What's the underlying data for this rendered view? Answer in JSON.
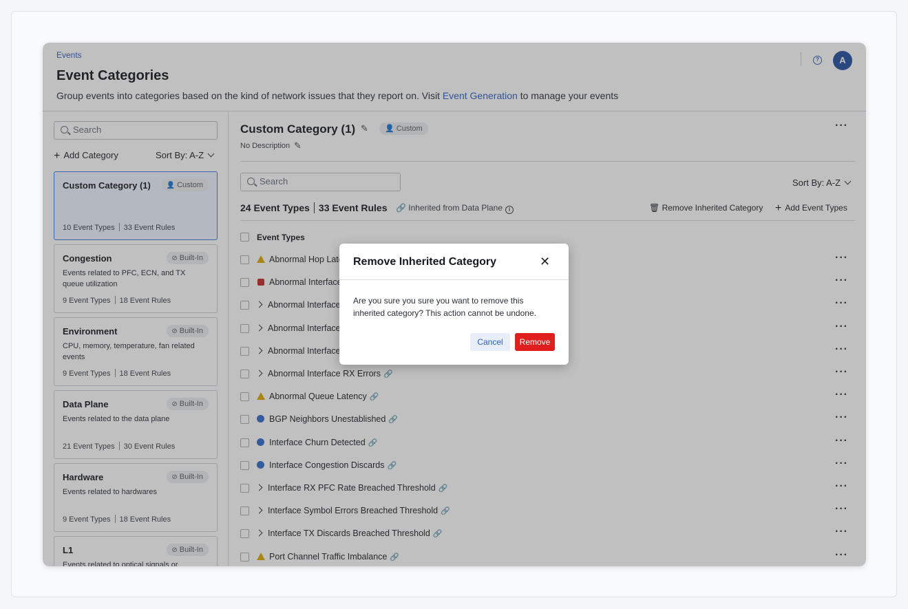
{
  "header": {
    "breadcrumb": "Events",
    "title": "Event Categories",
    "subtitle_before": "Group events into categories based on the kind of network issues that they report on. Visit ",
    "subtitle_link": "Event Generation",
    "subtitle_after": " to manage your events",
    "help_glyph": "?",
    "avatar_initial": "A"
  },
  "sidebar": {
    "search_placeholder": "Search",
    "add_label": "Add Category",
    "sort_label": "Sort By: A-Z",
    "categories": [
      {
        "name": "Custom Category (1)",
        "badge": "Custom",
        "desc": "",
        "types": "10 Event Types",
        "rules": "33 Event Rules"
      },
      {
        "name": "Congestion",
        "badge": "Built-In",
        "desc": "Events related to PFC, ECN, and TX queue utilization",
        "types": "9 Event Types",
        "rules": "18 Event Rules"
      },
      {
        "name": "Environment",
        "badge": "Built-In",
        "desc": "CPU, memory, temperature, fan related events",
        "types": "9 Event Types",
        "rules": "18 Event Rules"
      },
      {
        "name": "Data Plane",
        "badge": "Built-In",
        "desc": "Events related to the data plane",
        "types": "21 Event Types",
        "rules": "30 Event Rules"
      },
      {
        "name": "Hardware",
        "badge": "Built-In",
        "desc": "Events related to hardwares",
        "types": "9 Event Types",
        "rules": "18 Event Rules"
      },
      {
        "name": "L1",
        "badge": "Built-In",
        "desc": "Events related to optical signals or physical",
        "types": "",
        "rules": ""
      }
    ]
  },
  "main": {
    "title": "Custom Category (1)",
    "badge": "Custom",
    "description": "No Description",
    "search_placeholder": "Search",
    "sort_label": "Sort By: A-Z",
    "event_types_count": "24 Event Types",
    "event_rules_count": "33 Event Rules",
    "inherited_label": "Inherited from Data Plane",
    "remove_inherited_label": "Remove Inherited Category",
    "add_event_types_label": "Add Event Types",
    "column_header": "Event Types",
    "rows": [
      {
        "icon": "warning",
        "label": "Abnormal Hop Late"
      },
      {
        "icon": "critical",
        "label": "Abnormal Interface"
      },
      {
        "icon": "expand",
        "label": "Abnormal Interface"
      },
      {
        "icon": "expand",
        "label": "Abnormal Interface"
      },
      {
        "icon": "expand",
        "label": "Abnormal Interface"
      },
      {
        "icon": "expand",
        "label": "Abnormal Interface RX Errors"
      },
      {
        "icon": "warning",
        "label": "Abnormal Queue Latency"
      },
      {
        "icon": "info",
        "label": "BGP Neighbors Unestablished"
      },
      {
        "icon": "info",
        "label": "Interface Churn Detected"
      },
      {
        "icon": "info",
        "label": "Interface Congestion Discards"
      },
      {
        "icon": "expand",
        "label": "Interface RX PFC Rate Breached Threshold"
      },
      {
        "icon": "expand",
        "label": "Interface Symbol Errors Breached Threshold"
      },
      {
        "icon": "expand",
        "label": "Interface TX Discards Breached Threshold"
      },
      {
        "icon": "warning",
        "label": "Port Channel Traffic Imbalance"
      }
    ]
  },
  "modal": {
    "title": "Remove Inherited Category",
    "close_glyph": "✕",
    "body": "Are you sure you sure you want to remove this inherited category? This action cannot be undone.",
    "cancel_label": "Cancel",
    "remove_label": "Remove"
  },
  "colors": {
    "accent": "#2b5fbf",
    "danger": "#e01e1e",
    "warning": "#e0a800",
    "info": "#2e6bd0",
    "critical": "#c62828"
  }
}
